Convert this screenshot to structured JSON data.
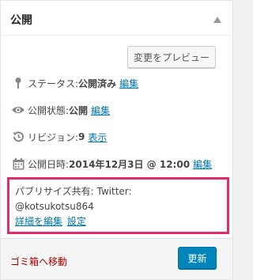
{
  "box": {
    "title": "公開"
  },
  "actions": {
    "preview_label": "変更をプレビュー"
  },
  "status": {
    "label": "ステータス: ",
    "value": "公開済み",
    "edit_link": "編集"
  },
  "visibility": {
    "label": "公開状態: ",
    "value": "公開",
    "edit_link": "編集"
  },
  "revisions": {
    "label": "リビジョン: ",
    "value": "9",
    "link": "表示"
  },
  "schedule": {
    "label": "公開日時: ",
    "value": "2014年12月3日 @ 12:00",
    "edit_link": "編集"
  },
  "publicize": {
    "line1": "パブリサイズ共有: Twitter:",
    "line2": "@kotsukotsu864",
    "edit_details_link": "詳細を編集",
    "settings_link": "設定"
  },
  "footer": {
    "trash_label": "ゴミ箱へ移動",
    "update_label": "更新"
  },
  "icons": {
    "status": "pin-icon",
    "visibility": "eye-icon",
    "revisions": "history-icon",
    "schedule": "calendar-icon"
  },
  "colors": {
    "link": "#0073aa",
    "primary_button": "#0085ba",
    "trash": "#a00",
    "highlight_border": "#e5276b"
  }
}
